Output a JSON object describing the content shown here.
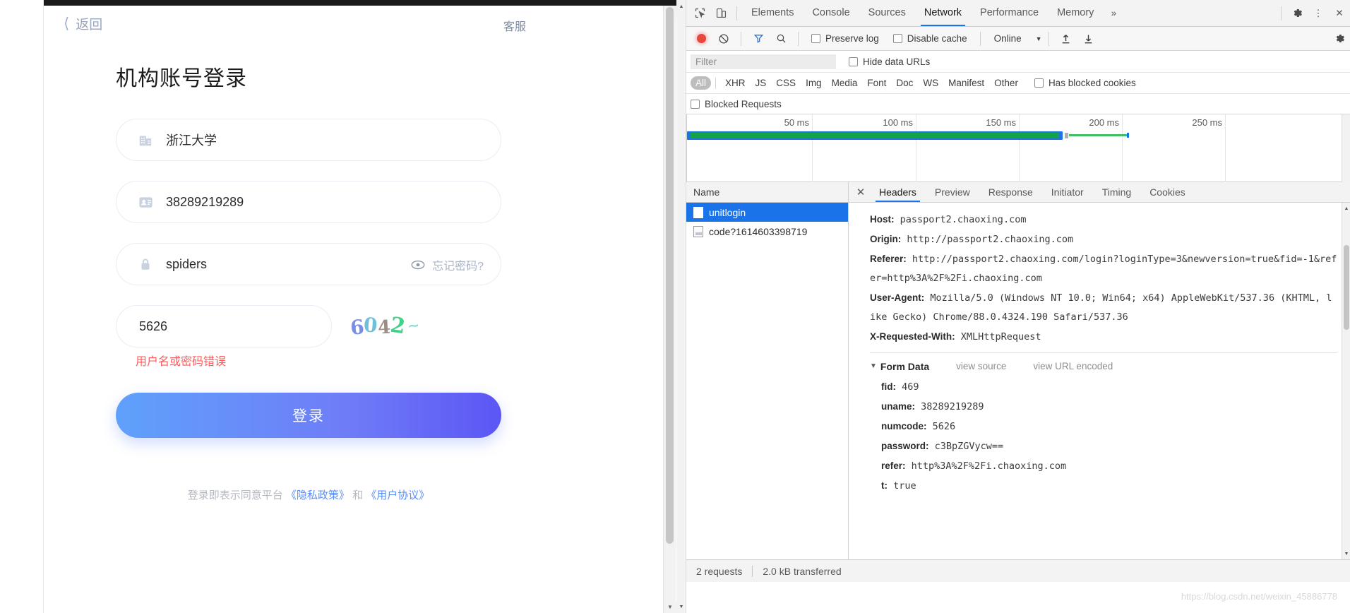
{
  "page": {
    "back_label": "返回",
    "support_label": "客服",
    "title": "机构账号登录",
    "fields": {
      "org": {
        "value": "浙江大学",
        "icon": "building-icon"
      },
      "account": {
        "value": "38289219289",
        "icon": "id-card-icon"
      },
      "password": {
        "value": "spiders",
        "icon": "lock-icon",
        "forgot_label": "忘记密码?",
        "eye_icon": "eye-icon"
      },
      "captcha": {
        "value": "5626",
        "image_text": "6042"
      }
    },
    "error_message": "用户名或密码错误",
    "submit_label": "登录",
    "agreement": {
      "prefix": "登录即表示同意平台",
      "privacy": "《隐私政策》",
      "and": "和",
      "terms": "《用户协议》"
    },
    "colors": {
      "button_gradient_start": "#5fa1fb",
      "button_gradient_end": "#5b56f6",
      "error": "#ff5a5a",
      "link": "#5b8df7"
    }
  },
  "devtools": {
    "tabs": [
      {
        "label": "Elements",
        "active": false
      },
      {
        "label": "Console",
        "active": false
      },
      {
        "label": "Sources",
        "active": false
      },
      {
        "label": "Network",
        "active": true
      },
      {
        "label": "Performance",
        "active": false
      },
      {
        "label": "Memory",
        "active": false
      }
    ],
    "more_tabs_icon": "chevron-double-right-icon",
    "settings_icon": "gear-icon",
    "menu_icon": "kebab-menu-icon",
    "close_icon": "close-icon",
    "inspect_icon": "inspect-element-icon",
    "device_icon": "device-toolbar-icon",
    "toolbar": {
      "record_icon": "record-button",
      "clear_icon": "clear-icon",
      "filter_icon": "filter-funnel-icon",
      "search_icon": "search-icon",
      "preserve_log": "Preserve log",
      "disable_cache": "Disable cache",
      "throttling": "Online",
      "import_icon": "import-har-icon",
      "export_icon": "export-har-icon",
      "settings_icon": "network-settings-icon"
    },
    "filter": {
      "placeholder": "Filter",
      "value": "",
      "hide_data_urls": "Hide data URLs",
      "has_blocked_cookies": "Has blocked cookies",
      "blocked_requests": "Blocked Requests"
    },
    "types": [
      "All",
      "XHR",
      "JS",
      "CSS",
      "Img",
      "Media",
      "Font",
      "Doc",
      "WS",
      "Manifest",
      "Other"
    ],
    "active_type": "All",
    "overview": {
      "ticks": [
        "50 ms",
        "100 ms",
        "150 ms",
        "200 ms",
        "250 ms"
      ]
    },
    "requests": {
      "column_header": "Name",
      "rows": [
        {
          "name": "unitlogin",
          "icon": "doc-icon",
          "selected": true
        },
        {
          "name": "code?1614603398719",
          "icon": "img-icon",
          "selected": false
        }
      ]
    },
    "detail_tabs": [
      {
        "label": "Headers",
        "active": true
      },
      {
        "label": "Preview",
        "active": false
      },
      {
        "label": "Response",
        "active": false
      },
      {
        "label": "Initiator",
        "active": false
      },
      {
        "label": "Timing",
        "active": false
      },
      {
        "label": "Cookies",
        "active": false
      }
    ],
    "headers": [
      {
        "key": "Host:",
        "value": "passport2.chaoxing.com"
      },
      {
        "key": "Origin:",
        "value": "http://passport2.chaoxing.com"
      },
      {
        "key": "Referer:",
        "value": "http://passport2.chaoxing.com/login?loginType=3&newversion=true&fid=-1&refer=http%3A%2F%2Fi.chaoxing.com"
      },
      {
        "key": "User-Agent:",
        "value": "Mozilla/5.0 (Windows NT 10.0; Win64; x64) AppleWebKit/537.36 (KHTML, like Gecko) Chrome/88.0.4324.190 Safari/537.36"
      },
      {
        "key": "X-Requested-With:",
        "value": "XMLHttpRequest"
      }
    ],
    "form_data": {
      "title": "Form Data",
      "view_source": "view source",
      "view_url_encoded": "view URL encoded",
      "rows": [
        {
          "key": "fid:",
          "value": "469"
        },
        {
          "key": "uname:",
          "value": "38289219289"
        },
        {
          "key": "numcode:",
          "value": "5626"
        },
        {
          "key": "password:",
          "value": "c3BpZGVycw=="
        },
        {
          "key": "refer:",
          "value": "http%3A%2F%2Fi.chaoxing.com"
        },
        {
          "key": "t:",
          "value": "true"
        }
      ]
    },
    "status_bar": {
      "requests": "2 requests",
      "transferred": "2.0 kB transferred"
    },
    "watermark": "https://blog.csdn.net/weixin_45886778"
  }
}
